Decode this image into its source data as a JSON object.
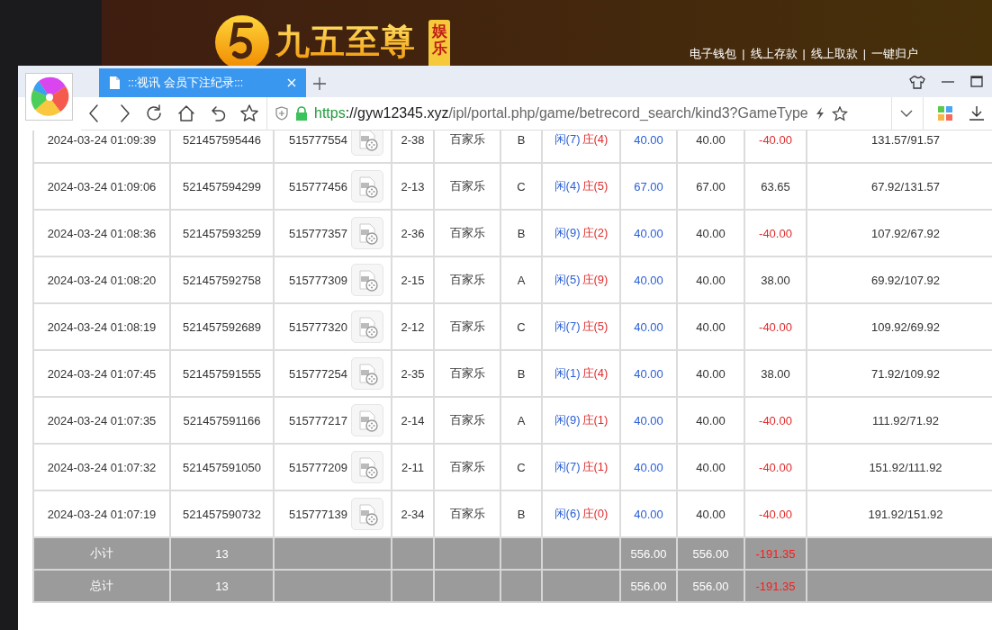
{
  "banner": {
    "brand": "九五至尊",
    "badge": "娱乐",
    "links": [
      "电子钱包",
      "线上存款",
      "线上取款",
      "一键归户"
    ],
    "separator": "|"
  },
  "browser": {
    "tab": {
      "title": ":::视讯 会员下注纪录:::",
      "selected": true
    },
    "url": {
      "scheme": "https",
      "host": "://gyw12345.xyz",
      "path": "/ipl/portal.php/game/betrecord_search/kind3?GameType"
    }
  },
  "rows": [
    {
      "time": "2024-03-24 01:09:39",
      "column_2": "521457595446",
      "column_3": "515777554",
      "column_4": "2-38",
      "column_5": "百家乐",
      "column_6": "B",
      "player": "闲(7)",
      "banker": "庄(4)",
      "bet": "40.00",
      "valid": "40.00",
      "win": {
        "text": "-40.00",
        "color": "#e02b2b"
      },
      "balance": "131.57/91.57"
    },
    {
      "time": "2024-03-24 01:09:06",
      "column_2": "521457594299",
      "column_3": "515777456",
      "column_4": "2-13",
      "column_5": "百家乐",
      "column_6": "C",
      "player": "闲(4)",
      "banker": "庄(5)",
      "bet": "67.00",
      "valid": "67.00",
      "win": {
        "text": "63.65",
        "color": "#333333"
      },
      "balance": "67.92/131.57"
    },
    {
      "time": "2024-03-24 01:08:36",
      "column_2": "521457593259",
      "column_3": "515777357",
      "column_4": "2-36",
      "column_5": "百家乐",
      "column_6": "B",
      "player": "闲(9)",
      "banker": "庄(2)",
      "bet": "40.00",
      "valid": "40.00",
      "win": {
        "text": "-40.00",
        "color": "#e02b2b"
      },
      "balance": "107.92/67.92"
    },
    {
      "time": "2024-03-24 01:08:20",
      "column_2": "521457592758",
      "column_3": "515777309",
      "column_4": "2-15",
      "column_5": "百家乐",
      "column_6": "A",
      "player": "闲(5)",
      "banker": "庄(9)",
      "bet": "40.00",
      "valid": "40.00",
      "win": {
        "text": "38.00",
        "color": "#333333"
      },
      "balance": "69.92/107.92"
    },
    {
      "time": "2024-03-24 01:08:19",
      "column_2": "521457592689",
      "column_3": "515777320",
      "column_4": "2-12",
      "column_5": "百家乐",
      "column_6": "C",
      "player": "闲(7)",
      "banker": "庄(5)",
      "bet": "40.00",
      "valid": "40.00",
      "win": {
        "text": "-40.00",
        "color": "#e02b2b"
      },
      "balance": "109.92/69.92"
    },
    {
      "time": "2024-03-24 01:07:45",
      "column_2": "521457591555",
      "column_3": "515777254",
      "column_4": "2-35",
      "column_5": "百家乐",
      "column_6": "B",
      "player": "闲(1)",
      "banker": "庄(4)",
      "bet": "40.00",
      "valid": "40.00",
      "win": {
        "text": "38.00",
        "color": "#333333"
      },
      "balance": "71.92/109.92"
    },
    {
      "time": "2024-03-24 01:07:35",
      "column_2": "521457591166",
      "column_3": "515777217",
      "column_4": "2-14",
      "column_5": "百家乐",
      "column_6": "A",
      "player": "闲(9)",
      "banker": "庄(1)",
      "bet": "40.00",
      "valid": "40.00",
      "win": {
        "text": "-40.00",
        "color": "#e02b2b"
      },
      "balance": "111.92/71.92"
    },
    {
      "time": "2024-03-24 01:07:32",
      "column_2": "521457591050",
      "column_3": "515777209",
      "column_4": "2-11",
      "column_5": "百家乐",
      "column_6": "C",
      "player": "闲(7)",
      "banker": "庄(1)",
      "bet": "40.00",
      "valid": "40.00",
      "win": {
        "text": "-40.00",
        "color": "#e02b2b"
      },
      "balance": "151.92/111.92"
    },
    {
      "time": "2024-03-24 01:07:19",
      "column_2": "521457590732",
      "column_3": "515777139",
      "column_4": "2-34",
      "column_5": "百家乐",
      "column_6": "B",
      "player": "闲(6)",
      "banker": "庄(0)",
      "bet": "40.00",
      "valid": "40.00",
      "win": {
        "text": "-40.00",
        "color": "#e02b2b"
      },
      "balance": "191.92/151.92"
    }
  ],
  "totals": [
    {
      "label": "小计",
      "count": "13",
      "bet": "556.00",
      "valid": "556.00",
      "win": "-191.35"
    },
    {
      "label": "总计",
      "count": "13",
      "bet": "556.00",
      "valid": "556.00",
      "win": "-191.35"
    }
  ]
}
